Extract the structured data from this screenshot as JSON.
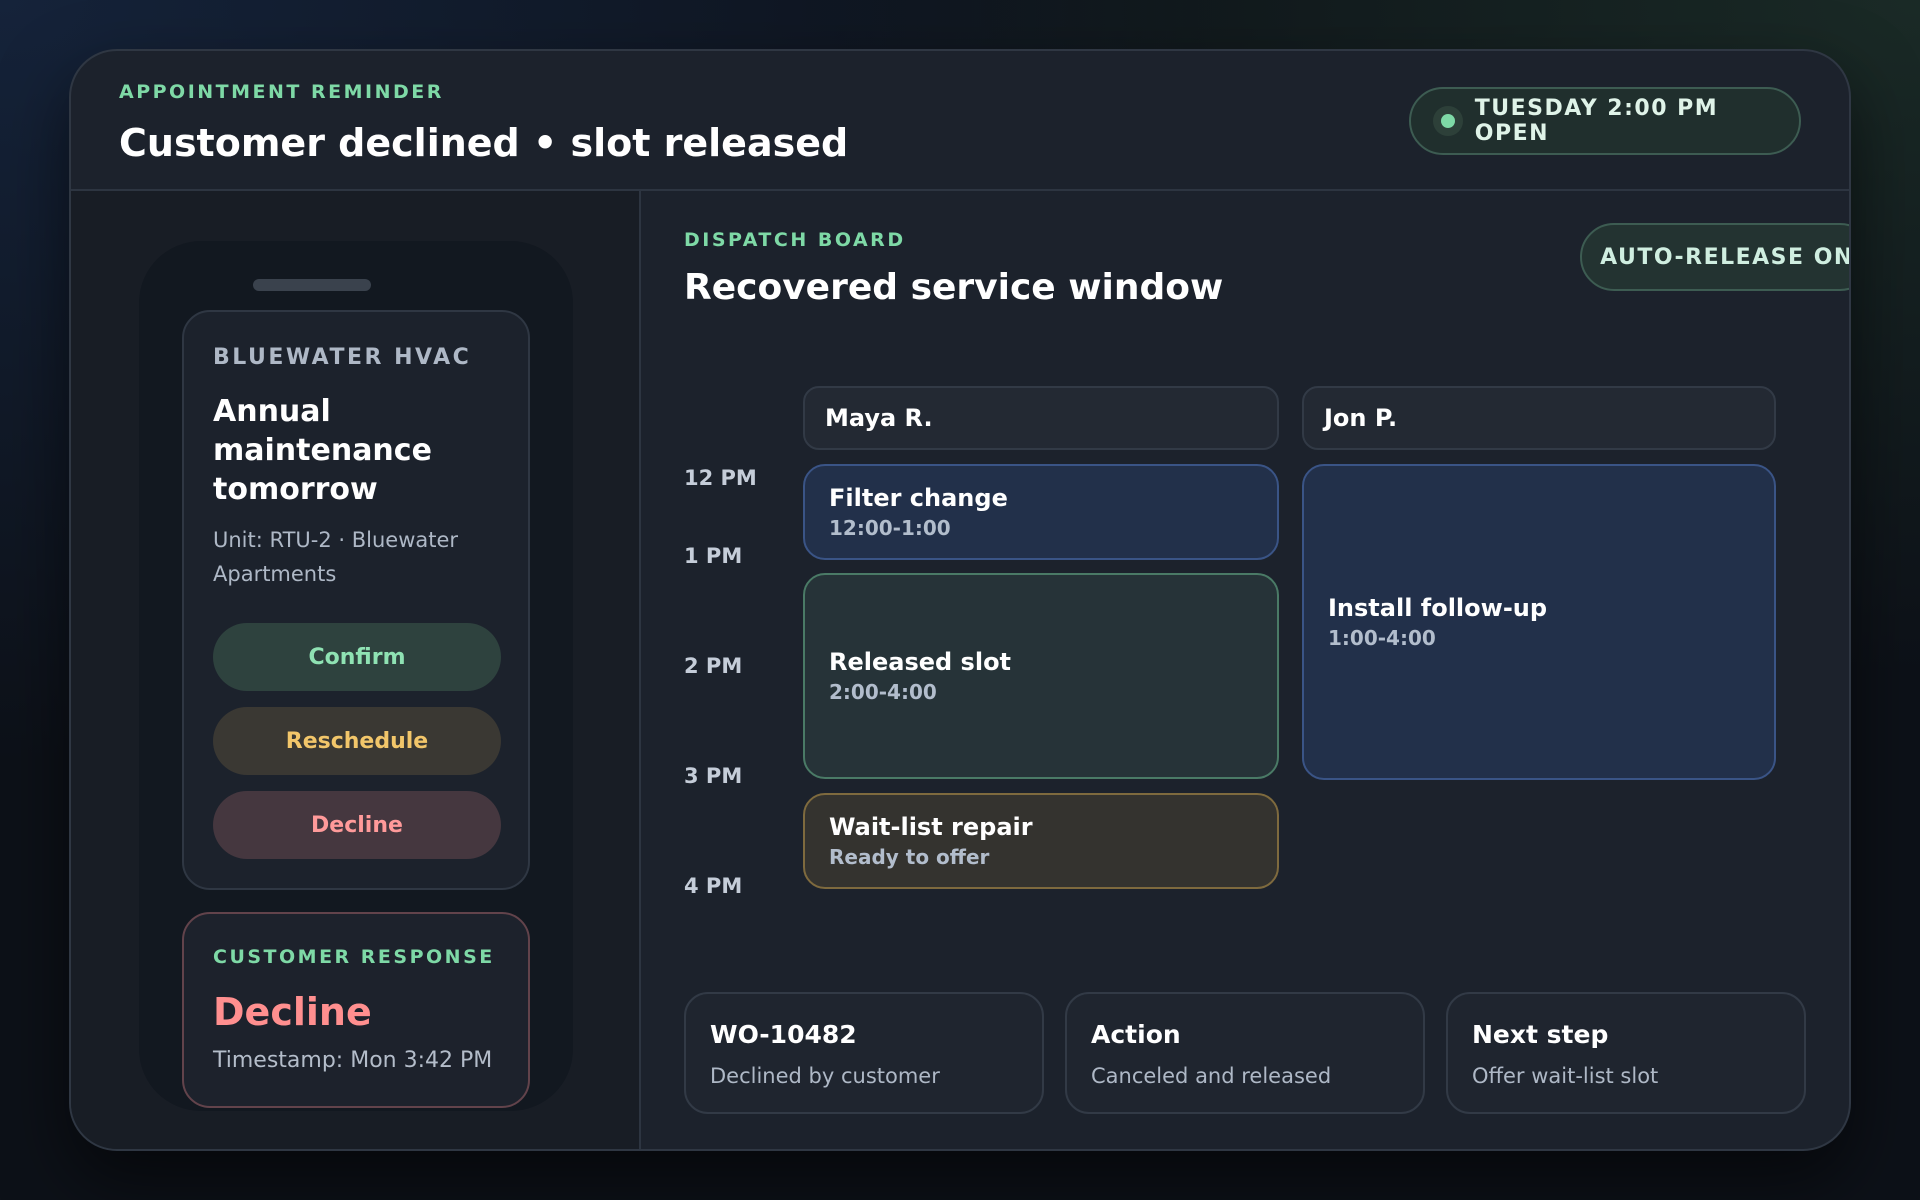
{
  "header": {
    "eyebrow": "APPOINTMENT REMINDER",
    "title": "Customer declined • slot released",
    "status_pill": "TUESDAY 2:00 PM OPEN"
  },
  "phone": {
    "brand": "BLUEWATER HVAC",
    "title": "Annual maintenance tomorrow",
    "unit": "Unit: RTU-2 · Bluewater Apartments",
    "buttons": {
      "confirm": "Confirm",
      "reschedule": "Reschedule",
      "decline": "Decline"
    }
  },
  "response": {
    "eyebrow": "CUSTOMER RESPONSE",
    "value": "Decline",
    "timestamp": "Timestamp: Mon 3:42 PM"
  },
  "dispatch": {
    "eyebrow": "DISPATCH BOARD",
    "title": "Recovered service window",
    "auto_release": "AUTO-RELEASE ON",
    "technicians": [
      "Maya R.",
      "Jon P."
    ],
    "time_labels": [
      "12 PM",
      "1 PM",
      "2 PM",
      "3 PM",
      "4 PM"
    ],
    "appointments": [
      {
        "title": "Filter change",
        "time": "12:00-1:00"
      },
      {
        "title": "Released slot",
        "time": "2:00-4:00"
      },
      {
        "title": "Wait-list repair",
        "time": "Ready to offer"
      },
      {
        "title": "Install follow-up",
        "time": "1:00-4:00"
      }
    ]
  },
  "summary": [
    {
      "title": "WO-10482",
      "sub": "Declined by customer"
    },
    {
      "title": "Action",
      "sub": "Canceled and released"
    },
    {
      "title": "Next step",
      "sub": "Offer wait-list slot"
    }
  ],
  "colors": {
    "accent_green": "#7ed9a6",
    "decline_red": "#ff8f8f",
    "reschedule_amber": "#f2c66a"
  }
}
